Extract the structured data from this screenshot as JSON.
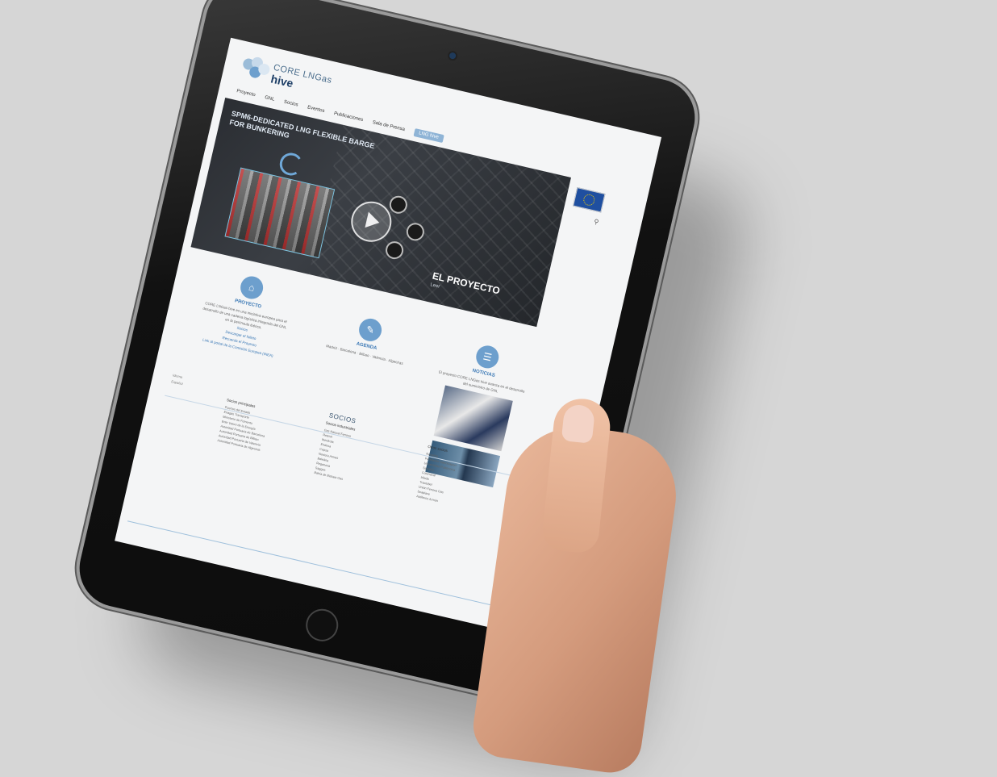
{
  "header": {
    "brand_top": "CORE LNGas",
    "brand_bottom": "hive",
    "nav": [
      "Proyecto",
      "GNL",
      "Socios",
      "Eventos",
      "Publicaciones",
      "Sala de Prensa"
    ],
    "nav_badge": "LNG hive"
  },
  "hero": {
    "title": "SPM6-DEDICATED LNG FLEXIBLE BARGE FOR BUNKERING",
    "caption": "EL PROYECTO",
    "subcaption": "Leer"
  },
  "columns": [
    {
      "heading": "PROYECTO",
      "text": "CORE LNGas hive es una iniciativa europea para el desarrollo de una cadena logística integrada del GNL en la península ibérica.",
      "links": [
        "Socios",
        "Descargar el folleto",
        "Recuerda el Proyecto",
        "Link al portal de la Comisión Europea (INEA)"
      ]
    },
    {
      "heading": "AGENDA",
      "text": "Madrid · Barcelona · Bilbao · Valencia · Algeciras"
    },
    {
      "heading": "NOTICIAS",
      "text": "El proyecto CORE LNGas hive avanza en el desarrollo del suministro de GNL"
    }
  ],
  "footer": {
    "socios_title": "SOCIOS",
    "lang_label": "Idioma",
    "lang_value": "Español",
    "partner_groups": [
      {
        "title": "Socios principales",
        "items": [
          "Puertos del Estado",
          "Enagás Transporte",
          "Ministerio de Fomento",
          "Ente Vasco de la Energía",
          "Autoridad Portuaria de Barcelona",
          "Autoridad Portuaria de Bilbao",
          "Autoridad Portuaria de Valencia",
          "Autoridad Portuaria de Algeciras"
        ]
      },
      {
        "title": "Socios industriales",
        "items": [
          "Gas Natural Fenosa",
          "Repsol",
          "Iberdrola",
          "Endesa",
          "Cepsa",
          "Naviera Armas",
          "Baleària",
          "Reganosa",
          "Saggas",
          "Bahía de Bizkaia Gas"
        ]
      },
      {
        "title": "Otros socios",
        "items": [
          "Navantia",
          "Fundación Valenciaport",
          "Universidad Politécnica",
          "Siport21",
          "Cotenaval",
          "Idiada",
          "Tractebel",
          "Unión Fenosa Gas",
          "Seaplace",
          "Astilleros Armón"
        ]
      }
    ]
  },
  "colors": {
    "accent": "#3a78b5",
    "icon_circle": "#6d9fcd",
    "brand_dark": "#1d3e66",
    "background": "#d6d6d6"
  }
}
